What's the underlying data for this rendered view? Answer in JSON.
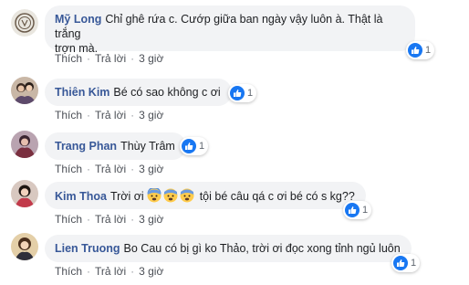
{
  "comments": [
    {
      "author": "Mỹ Long",
      "text_line1": "Chỉ ghê rứa c. Cướp giữa ban ngày vậy luôn à. Thật là trắng",
      "text_line2": "trợn mà.",
      "likes": "1",
      "like_label": "Thích",
      "reply_label": "Trả lời",
      "time": "3 giờ"
    },
    {
      "author": "Thiên Kim",
      "text": "Bé có sao không c ơi",
      "likes": "1",
      "like_label": "Thích",
      "reply_label": "Trả lời",
      "time": "3 giờ"
    },
    {
      "author": "Trang Phan",
      "text": "Thùy Trâm",
      "likes": "1",
      "like_label": "Thích",
      "reply_label": "Trả lời",
      "time": "3 giờ"
    },
    {
      "author": "Kim Thoa",
      "text_before": "Trời ơi",
      "text_after": "tội bé câu qá c ơi bé có s kg??",
      "emoji": "fearful-face-icon",
      "likes": "1",
      "like_label": "Thích",
      "reply_label": "Trả lời",
      "time": "3 giờ"
    },
    {
      "author": "Lien Truong",
      "text": "Bo Cau có bị gì ko Thảo, trời ơi đọc xong tỉnh ngủ luôn",
      "likes": "1",
      "like_label": "Thích",
      "reply_label": "Trả lời",
      "time": "3 giờ"
    }
  ],
  "separator": "·",
  "colors": {
    "author": "#385898",
    "bubble": "#f2f3f5",
    "like_blue": "#1877f2",
    "meta": "#606770"
  }
}
